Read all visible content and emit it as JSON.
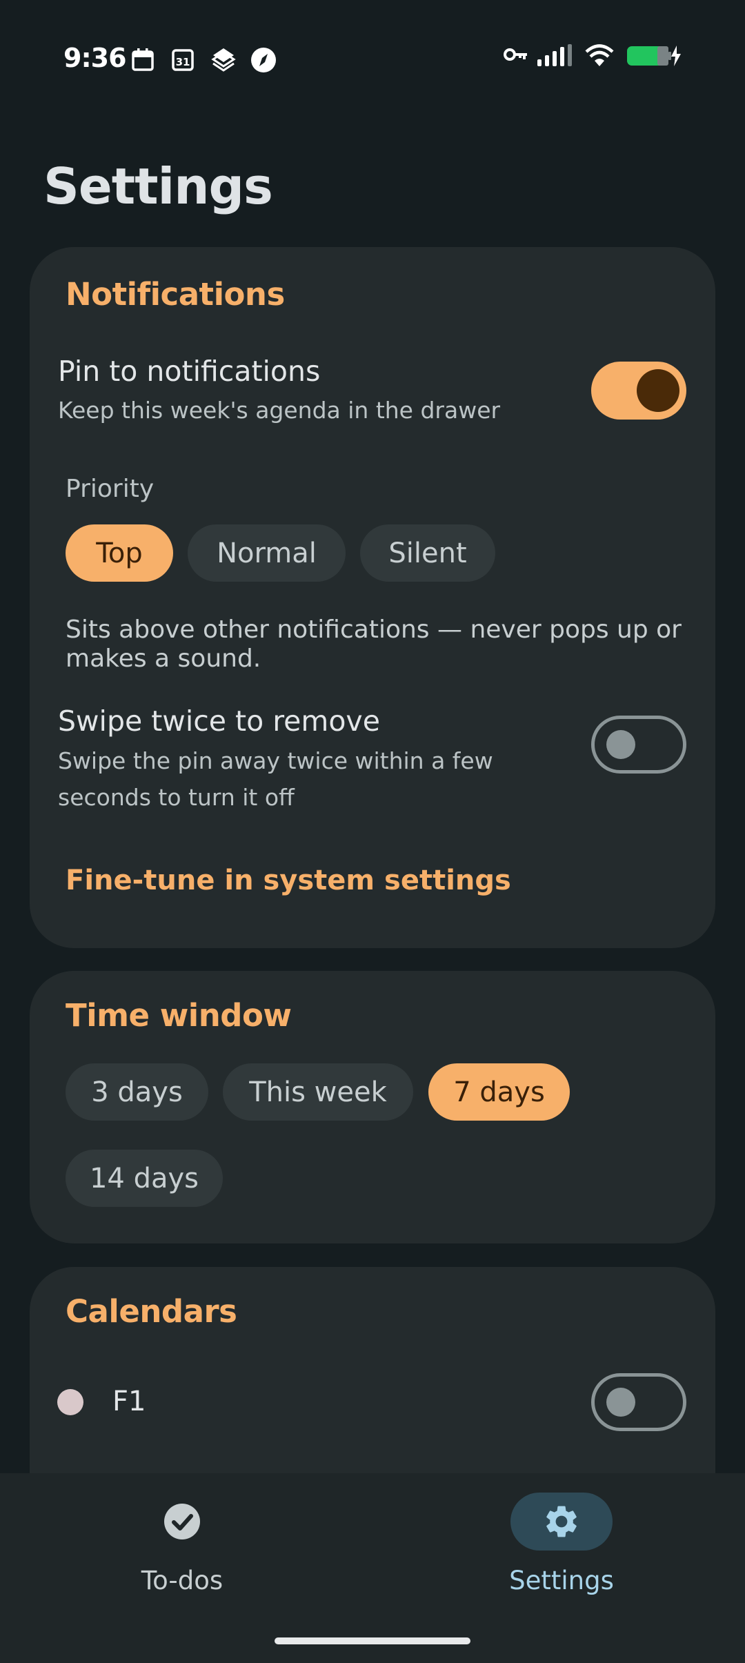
{
  "status_bar": {
    "time": "9:36",
    "left_icons": [
      "calendar-icon",
      "calendar-31-icon",
      "layers-icon",
      "compass-icon"
    ],
    "right_icons": [
      "vpn-key-icon",
      "signal-icon",
      "wifi-icon",
      "battery-charging-icon"
    ],
    "battery_color": "#22c55e"
  },
  "page": {
    "title": "Settings"
  },
  "notifications": {
    "title": "Notifications",
    "pin": {
      "title": "Pin to notifications",
      "subtitle": "Keep this week's agenda in the drawer",
      "enabled": true
    },
    "priority_label": "Priority",
    "priority_options": [
      "Top",
      "Normal",
      "Silent"
    ],
    "priority_selected": "Top",
    "priority_description": "Sits above other notifications — never pops up or makes a sound.",
    "swipe": {
      "title": "Swipe twice to remove",
      "subtitle": "Swipe the pin away twice within a few seconds to turn it off",
      "enabled": false
    },
    "system_link": "Fine-tune in system settings"
  },
  "time_window": {
    "title": "Time window",
    "options": [
      "3 days",
      "This week",
      "7 days",
      "14 days"
    ],
    "selected": "7 days"
  },
  "calendars": {
    "title": "Calendars",
    "items": [
      {
        "label": "F1",
        "color": "#d9c8ca",
        "enabled": false
      }
    ]
  },
  "bottom_nav": {
    "items": [
      {
        "label": "To-dos",
        "icon": "check-circle-icon",
        "active": false
      },
      {
        "label": "Settings",
        "icon": "gear-icon",
        "active": true
      }
    ]
  },
  "colors": {
    "accent": "#f7b06a",
    "background": "#151d20",
    "card": "#242b2d",
    "nav_active": "#a8d4ea"
  }
}
